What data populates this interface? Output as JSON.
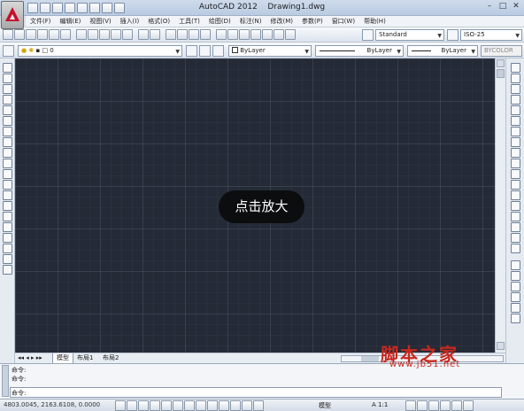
{
  "window": {
    "app_title": "AutoCAD 2012",
    "doc_title": "Drawing1.dwg"
  },
  "menu": [
    "文件(F)",
    "编辑(E)",
    "视图(V)",
    "插入(I)",
    "格式(O)",
    "工具(T)",
    "绘图(D)",
    "标注(N)",
    "修改(M)",
    "参数(P)",
    "窗口(W)",
    "帮助(H)"
  ],
  "toolbar": {
    "text_style": "Standard",
    "dim_style": "ISO-25",
    "layer": "0",
    "color": "ByLayer",
    "linetype": "ByLayer",
    "lineweight": "ByLayer",
    "plotstyle": "BYCOLOR"
  },
  "layout_tabs": [
    "模型",
    "布局1",
    "布局2"
  ],
  "command": {
    "line1": "命令:",
    "line2": "命令:",
    "prompt": "命令:"
  },
  "status": {
    "coords": "4803.0045, 2163.6108, 0.0000",
    "model_label": "模型",
    "scale": "A 1:1"
  },
  "overlay": {
    "zoom_button": "点击放大"
  },
  "watermark": {
    "text": "脚本之家",
    "url": "www.jb51.net"
  }
}
